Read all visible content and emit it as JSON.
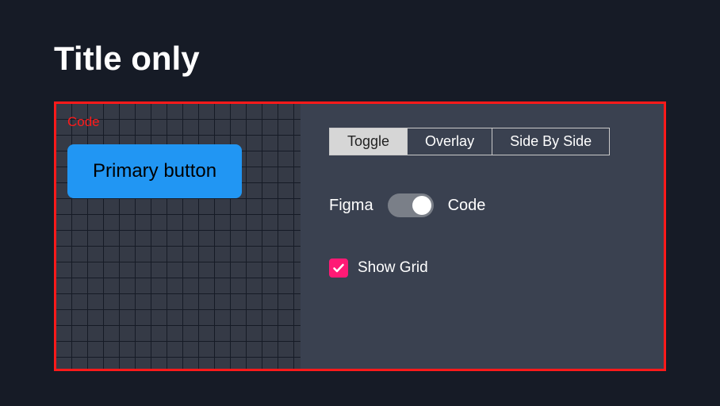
{
  "title": "Title only",
  "preview": {
    "mode_label": "Code",
    "button_text": "Primary button"
  },
  "controls": {
    "segmented": {
      "options": [
        "Toggle",
        "Overlay",
        "Side By Side"
      ],
      "active": "Toggle"
    },
    "switch": {
      "left_label": "Figma",
      "right_label": "Code",
      "value": "Code"
    },
    "checkbox": {
      "label": "Show Grid",
      "checked": true
    }
  },
  "colors": {
    "bg": "#161b26",
    "panel_border": "#ff1a1a",
    "preview_bg": "#353a46",
    "controls_bg": "#3a4150",
    "primary_button": "#2196f3",
    "checkbox": "#ff1a75"
  }
}
